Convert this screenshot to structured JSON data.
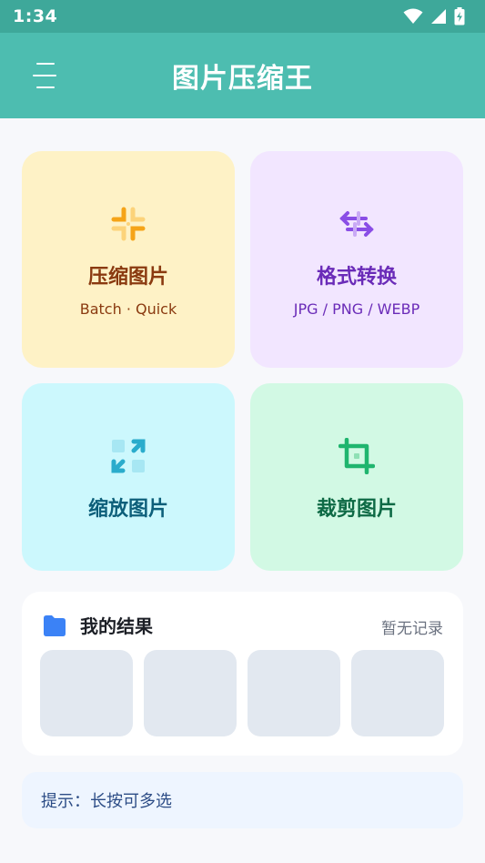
{
  "status_bar": {
    "time": "1:34",
    "icons": [
      "wifi-icon",
      "signal-icon",
      "battery-charging-icon"
    ]
  },
  "app_bar": {
    "title": "图片压缩王",
    "menu_icon": "menu-icon"
  },
  "features": [
    {
      "title": "压缩图片",
      "subtitle": "Batch · Quick",
      "icon": "compress-icon",
      "color": "#f5a418"
    },
    {
      "title": "格式转换",
      "subtitle": "JPG / PNG / WEBP",
      "icon": "convert-arrows-icon",
      "color": "#8a4ee6"
    },
    {
      "title": "缩放图片",
      "icon": "resize-icon",
      "color": "#2aaccc"
    },
    {
      "title": "裁剪图片",
      "icon": "crop-icon",
      "color": "#1fb56e"
    }
  ],
  "results": {
    "title": "我的结果",
    "empty_label": "暂无记录",
    "icon": "folder-icon",
    "accent": "#3b82f6"
  },
  "tip": "提示：长按可多选"
}
